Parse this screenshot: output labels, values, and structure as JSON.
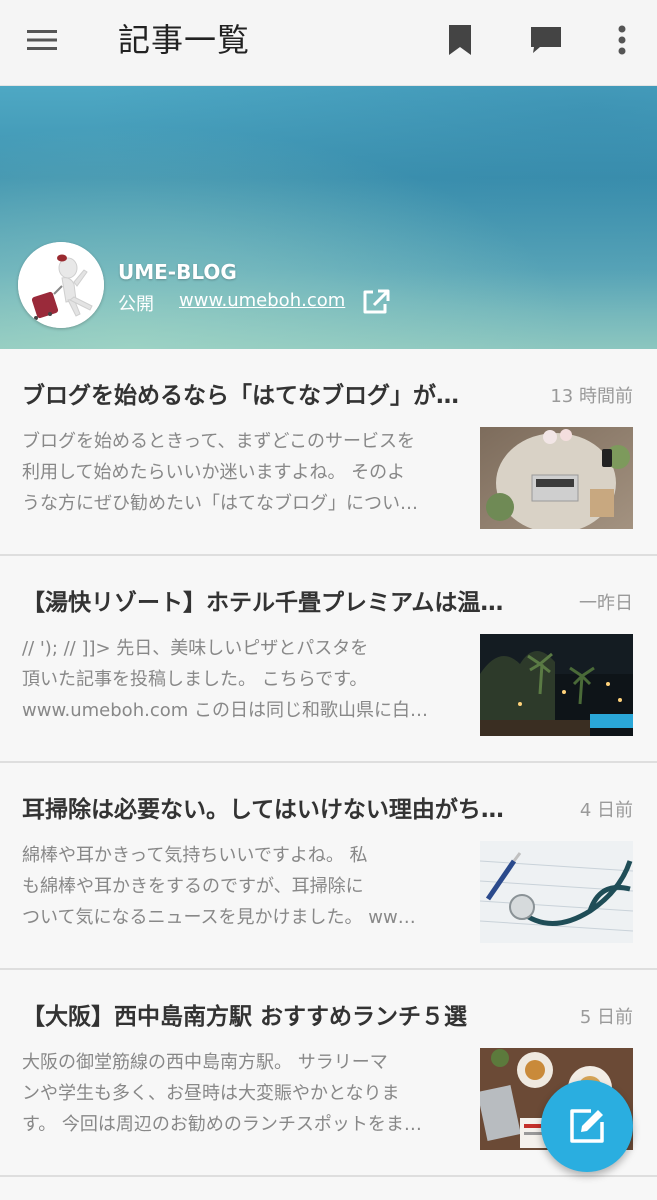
{
  "appbar": {
    "title": "記事一覧",
    "icons": [
      "menu-icon",
      "bookmark-icon",
      "comment-icon",
      "more-vert-icon"
    ]
  },
  "blog": {
    "name": "UME-BLOG",
    "visibility": "公開",
    "url": "www.umeboh.com",
    "banner_colors": [
      "#4ea8c4",
      "#8cc6bf"
    ]
  },
  "articles": [
    {
      "title": "ブログを始めるなら「はてなブログ」が…",
      "time": "13 時間前",
      "excerpt": [
        "ブログを始めるときって、まずどこのサービスを",
        "利用して始めたらいいか迷いますよね。 そのよ",
        "うな方にぜひ勧めたい「はてなブログ」につい…"
      ],
      "thumb": "laptop-desk-photo"
    },
    {
      "title": "【湯快リゾート】ホテル千畳プレミアムは温…",
      "time": "一昨日",
      "excerpt": [
        "// '); // ]]> 先日、美味しいピザとパスタを",
        "頂いた記事を投稿しました。 こちらです。",
        "www.umeboh.com この日は同じ和歌山県に白…"
      ],
      "thumb": "night-resort-photo"
    },
    {
      "title": "耳掃除は必要ない。してはいけない理由がち…",
      "time": "4 日前",
      "excerpt": [
        "綿棒や耳かきって気持ちいいですよね。 私",
        "も綿棒や耳かきをするのですが、耳掃除に",
        "ついて気になるニュースを見かけました。 ww…"
      ],
      "thumb": "stethoscope-photo"
    },
    {
      "title": "【大阪】西中島南方駅 おすすめランチ５選",
      "time": "5 日前",
      "excerpt": [
        "大阪の御堂筋線の西中島南方駅。 サラリーマ",
        "ンや学生も多く、お昼時は大変賑やかとなりま",
        "す。 今回は周辺のお勧めのランチスポットをま…"
      ],
      "thumb": "lunch-table-photo"
    }
  ],
  "fab": {
    "icon": "edit-icon",
    "color": "#2aaee0"
  }
}
